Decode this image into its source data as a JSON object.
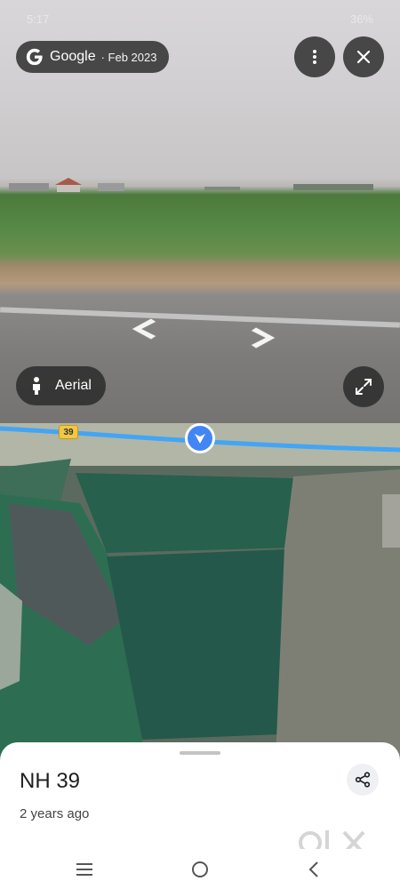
{
  "status_bar": {
    "time": "5:17",
    "battery": "36%"
  },
  "imagery_source": {
    "brand": "Google",
    "date": "· Feb 2023"
  },
  "controls": {
    "view_mode_label": "Aerial",
    "route_number": "39"
  },
  "place": {
    "name": "NH 39",
    "age": "2 years ago"
  },
  "icons": {
    "google_logo": "google-g-logo",
    "more_menu": "vertical-dots-icon",
    "close": "close-icon",
    "pegman": "person-icon",
    "expand": "expand-icon",
    "share": "share-icon",
    "nav_menu": "menu-icon",
    "nav_home": "home-icon",
    "nav_back": "back-icon"
  },
  "colors": {
    "accent_blue": "#4285f4",
    "route_badge": "#f2c744"
  },
  "watermark": "OLX"
}
